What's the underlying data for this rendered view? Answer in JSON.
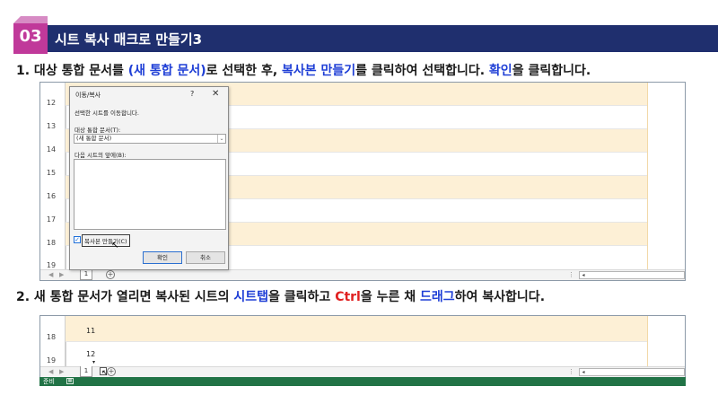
{
  "header": {
    "number": "03",
    "title": "시트 복사 매크로 만들기3",
    "colors": {
      "bar": "#1f2f6e",
      "badge": "#c0399a"
    }
  },
  "step1": {
    "prefix": "1.  대상 통합 문서를 ",
    "hl1": "(새 통합 문서)",
    "mid1": "로 선택한 후, ",
    "hl2": "복사본 만들기",
    "mid2": "를 클릭하여 선택합니다. ",
    "hl3": "확인",
    "suffix": "을 클릭합니다."
  },
  "step2": {
    "prefix": "2.  새 통합 문서가 열리면 복사된 시트의 ",
    "hl1": "시트탭",
    "mid1": "을 클릭하고 ",
    "hl2": "Ctrl",
    "mid2": "을 누른 채 ",
    "hl3": "드래그",
    "suffix": "하여 복사합니다."
  },
  "shot1": {
    "rows": [
      "12",
      "13",
      "14",
      "15",
      "16",
      "17",
      "18",
      "19"
    ],
    "sheet_tab": "1",
    "add_sheet": "+"
  },
  "dialog": {
    "title": "이동/복사",
    "help": "?",
    "close": "✕",
    "instruction": "선택한 시트를 이동합니다.",
    "target_label": "대상 통합 문서(T):",
    "target_value": "(새 통합 문서)",
    "before_label": "다음 시트의 앞에(B):",
    "copy_checkbox_label": "복사본 만들기(C)",
    "copy_checked": true,
    "ok": "확인",
    "cancel": "취소"
  },
  "shot2": {
    "rows": [
      "18",
      "19"
    ],
    "cells": [
      "11",
      "12"
    ],
    "sheet_tab": "1",
    "add_sheet": "+"
  },
  "statusbar": {
    "label": "준비"
  }
}
